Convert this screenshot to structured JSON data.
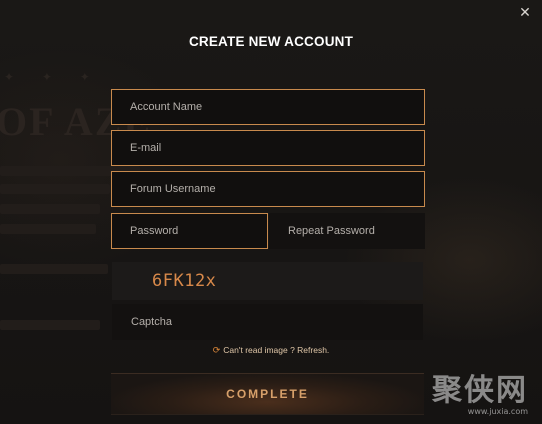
{
  "dialog": {
    "title": "CREATE NEW ACCOUNT",
    "close_icon": "close-icon",
    "fields": {
      "account_name": {
        "placeholder": "Account Name"
      },
      "email": {
        "placeholder": "E-mail"
      },
      "forum_username": {
        "placeholder": "Forum Username"
      },
      "password": {
        "placeholder": "Password"
      },
      "repeat_password": {
        "placeholder": "Repeat Password"
      },
      "captcha": {
        "placeholder": "Captcha"
      }
    },
    "captcha_image_text": "6FK12x",
    "refresh": {
      "icon": "refresh-icon",
      "label": "Can't read image ? Refresh."
    },
    "complete_label": "COMPLETE"
  },
  "background": {
    "heading_fragment": "OF AZE"
  },
  "colors": {
    "accent_border": "#c88a4d",
    "captcha_text": "#d8894a",
    "refresh_icon": "#e08a3a"
  },
  "watermark": {
    "logo_text": "聚侠网",
    "url": "www.juxia.com"
  }
}
